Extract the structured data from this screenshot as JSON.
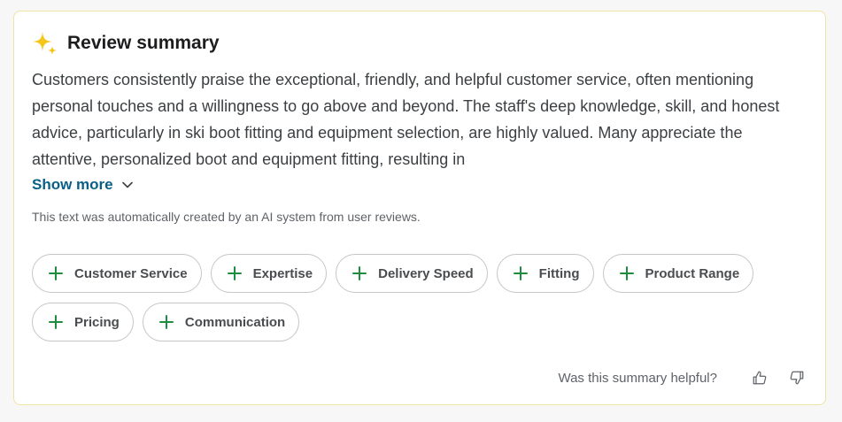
{
  "review_summary": {
    "title": "Review summary",
    "icon": "sparkle-icon",
    "accent_color": "#f5c518",
    "summary_text": "Customers consistently praise the exceptional, friendly, and helpful customer service, often mentioning personal touches and a willingness to go above and beyond. The staff's deep knowledge, skill, and honest advice, particularly in ski boot fitting and equipment selection, are highly valued. Many appreciate the attentive, personalized boot and equipment fitting, resulting in",
    "show_more_label": "Show more",
    "disclaimer": "This text was automatically created by an AI system from user reviews.",
    "topics_row1": [
      "Customer Service",
      "Expertise",
      "Delivery Speed",
      "Fitting",
      "Product Range"
    ],
    "topics_row2": [
      "Pricing",
      "Communication"
    ],
    "plus_icon_color": "#1e8e3e",
    "feedback_question": "Was this summary helpful?"
  }
}
